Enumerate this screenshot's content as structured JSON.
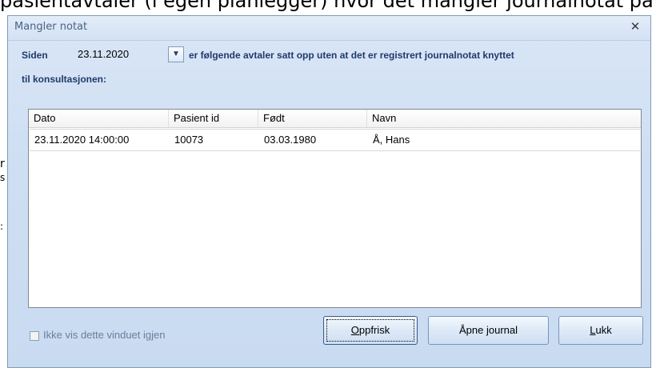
{
  "background": {
    "top_text": "pasientavtaler (i egen planlegger) hvor det mangler journalnotat på",
    "fragments": [
      "r",
      "s",
      ":"
    ]
  },
  "dialog": {
    "title": "Mangler notat",
    "close_icon": "close-x-icon",
    "since_label": "Siden",
    "date_value": "23.11.2020",
    "dropdown_icon": "chevron-down-icon",
    "message_line1": "er følgende avtaler satt opp uten at det er registrert journalnotat knyttet",
    "message_line2": "til konsultasjonen:",
    "columns": [
      "Dato",
      "Pasient id",
      "Født",
      "Navn"
    ],
    "rows": [
      {
        "dato": "23.11.2020 14:00:00",
        "pasient_id": "10073",
        "fodt": "03.03.1980",
        "navn": "Å, Hans"
      }
    ],
    "checkbox_label": "Ikke vis dette vinduet igjen",
    "checkbox_checked": false,
    "buttons": {
      "refresh": {
        "accel": "O",
        "rest": "ppfrisk"
      },
      "open_journal": {
        "pre": "Åpne ",
        "accel": "j",
        "rest": "ournal"
      },
      "close": {
        "accel": "L",
        "rest": "ukk"
      }
    }
  }
}
